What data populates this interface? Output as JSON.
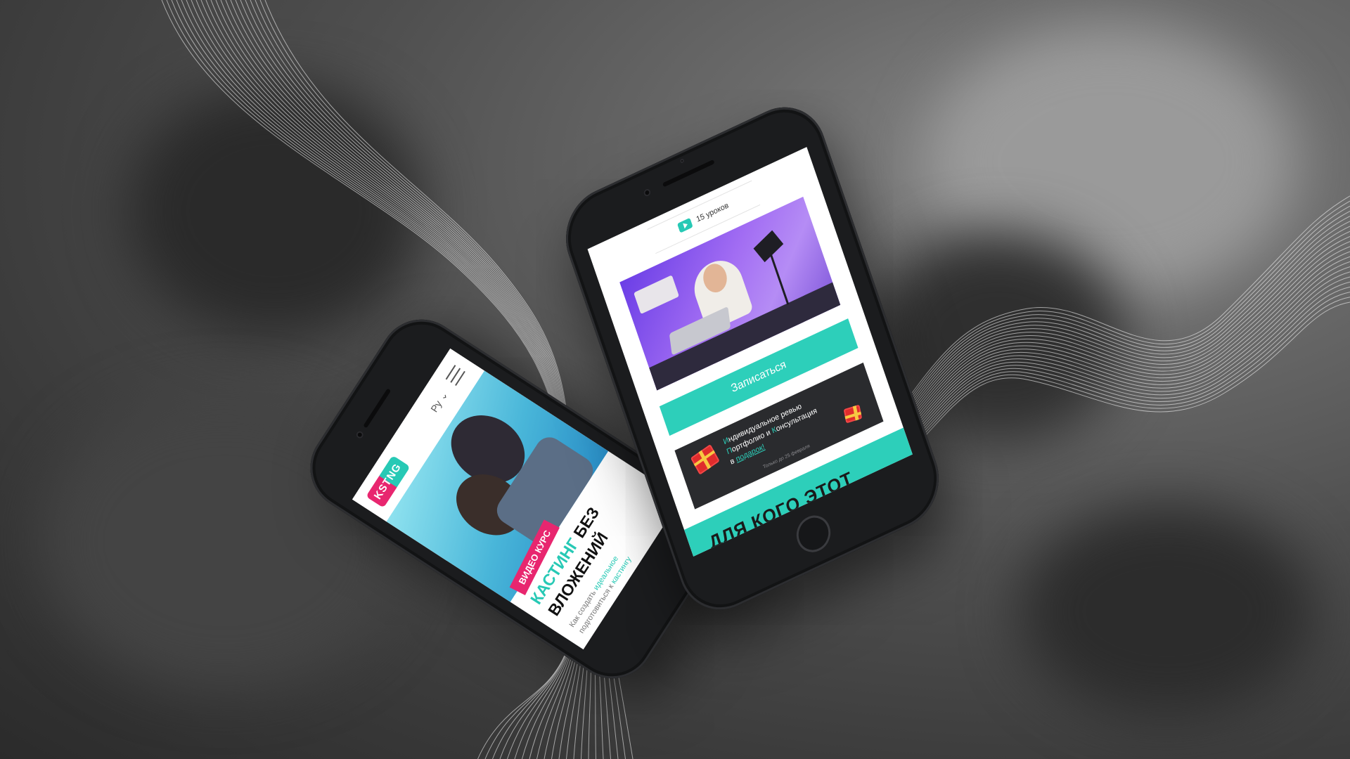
{
  "phone_left": {
    "lang_label": "Ру",
    "badge": "ВИДЕО КУРС",
    "title_accent": "КАСТИНГ",
    "title_rest": " БЕЗ",
    "title_line2": "ВЛОЖЕНИЙ",
    "desc_line1_a": "Как создать ",
    "desc_line1_accent": "идеальное",
    "desc_line2_a": "подготовиться к ",
    "desc_line2_accent": "кастингу"
  },
  "phone_right": {
    "lessons_label": "15 уроков",
    "signup_button": "Записаться",
    "gift": {
      "line1_cap": "И",
      "line1_rest": "ндивидуальное ревью",
      "line2_cap1": "П",
      "line2_mid": "ортфолио и ",
      "line2_cap2": "К",
      "line2_rest": "онсультация",
      "line3_prefix": "в ",
      "line3_link": "подарок!",
      "note": "Только до 25 февраля"
    },
    "section_title": "ДЛЯ КОГО ЭТОТ"
  },
  "colors": {
    "accent_teal": "#2dcfba",
    "accent_pink": "#e8266f",
    "gift_dark": "#2a2b2e"
  }
}
